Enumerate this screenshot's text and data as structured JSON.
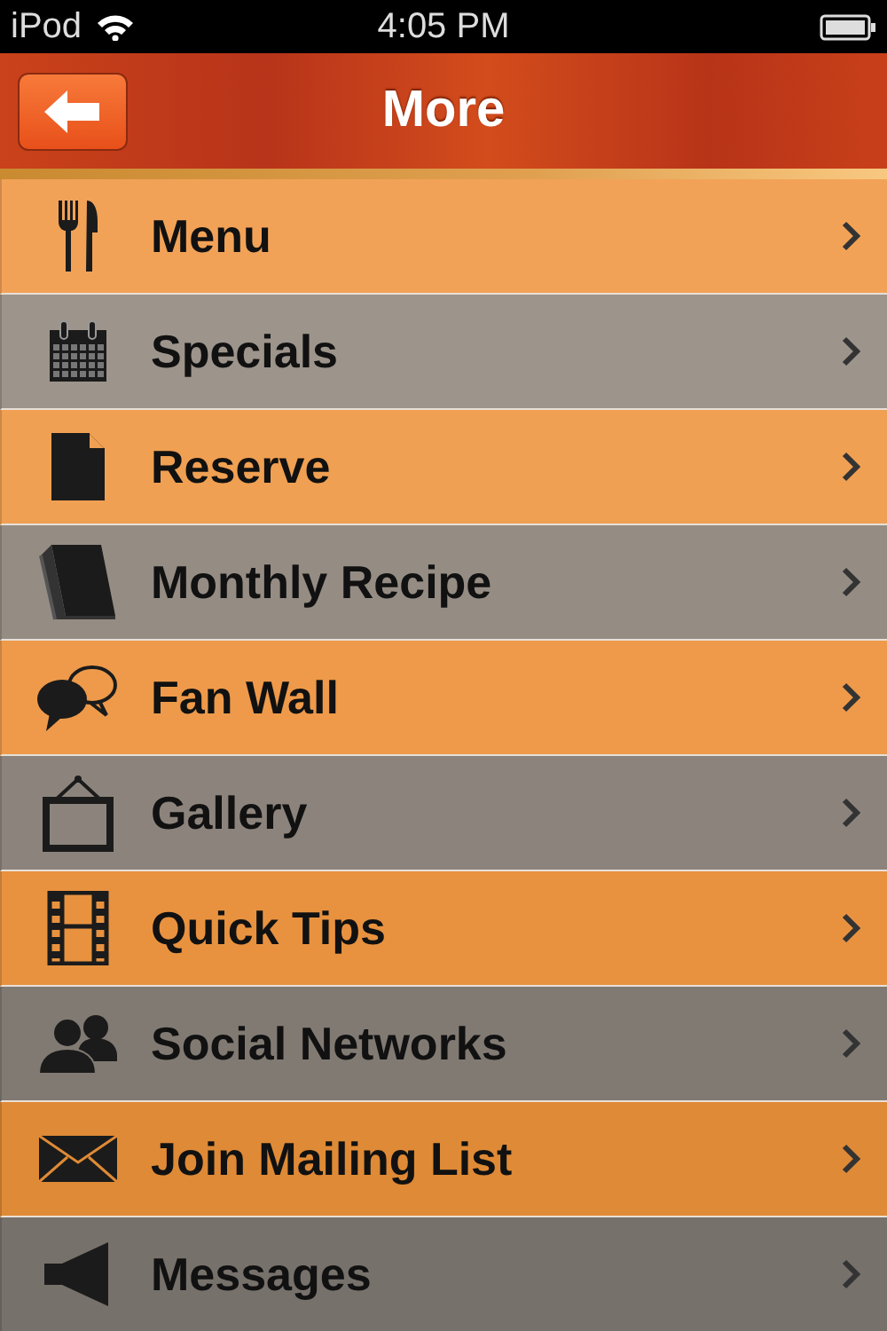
{
  "status_bar": {
    "carrier": "iPod",
    "time": "4:05 PM"
  },
  "nav_bar": {
    "title": "More"
  },
  "items": [
    {
      "label": "Menu",
      "color": "#f2a257"
    },
    {
      "label": "Specials",
      "color": "#9d948b"
    },
    {
      "label": "Reserve",
      "color": "#f0a052"
    },
    {
      "label": "Monthly Recipe",
      "color": "#958c84"
    },
    {
      "label": "Fan Wall",
      "color": "#ee9a4a"
    },
    {
      "label": "Gallery",
      "color": "#8c847c"
    },
    {
      "label": "Quick Tips",
      "color": "#e89240"
    },
    {
      "label": "Social Networks",
      "color": "#817a73"
    },
    {
      "label": "Join Mailing List",
      "color": "#df8a36"
    },
    {
      "label": "Messages",
      "color": "#77716b"
    }
  ]
}
